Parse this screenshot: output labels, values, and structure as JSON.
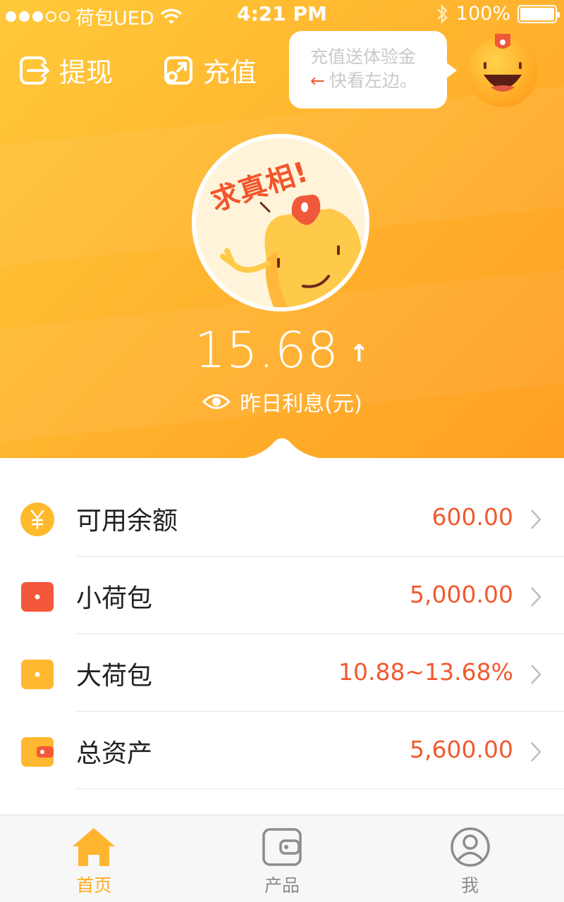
{
  "status_bar": {
    "carrier": "荷包UED",
    "time": "4:21 PM",
    "battery": "100%"
  },
  "header": {
    "withdraw_label": "提现",
    "recharge_label": "充值",
    "bubble_line1": "充值送体验金",
    "bubble_arrow": "←",
    "bubble_line2": "快看左边。"
  },
  "avatar": {
    "sticker_text": "求真相!"
  },
  "interest": {
    "value": "15.68",
    "trend_icon": "↑",
    "label": "昨日利息(元)"
  },
  "list": {
    "items": [
      {
        "icon": "yuan-coin-icon",
        "label": "可用余额",
        "value": "600.00"
      },
      {
        "icon": "small-wallet-icon",
        "label": "小荷包",
        "value": "5,000.00"
      },
      {
        "icon": "big-wallet-icon",
        "label": "大荷包",
        "value": "10.88~13.68%"
      },
      {
        "icon": "purse-icon",
        "label": "总资产",
        "value": "5,600.00"
      }
    ]
  },
  "tabbar": {
    "tabs": [
      {
        "label": "首页",
        "icon": "home-icon",
        "active": true
      },
      {
        "label": "产品",
        "icon": "wallet-icon",
        "active": false
      },
      {
        "label": "我",
        "icon": "user-icon",
        "active": false
      }
    ]
  },
  "colors": {
    "accent": "#ffb52f",
    "value_red": "#f05a2e",
    "tab_active": "#ffaa1e"
  }
}
